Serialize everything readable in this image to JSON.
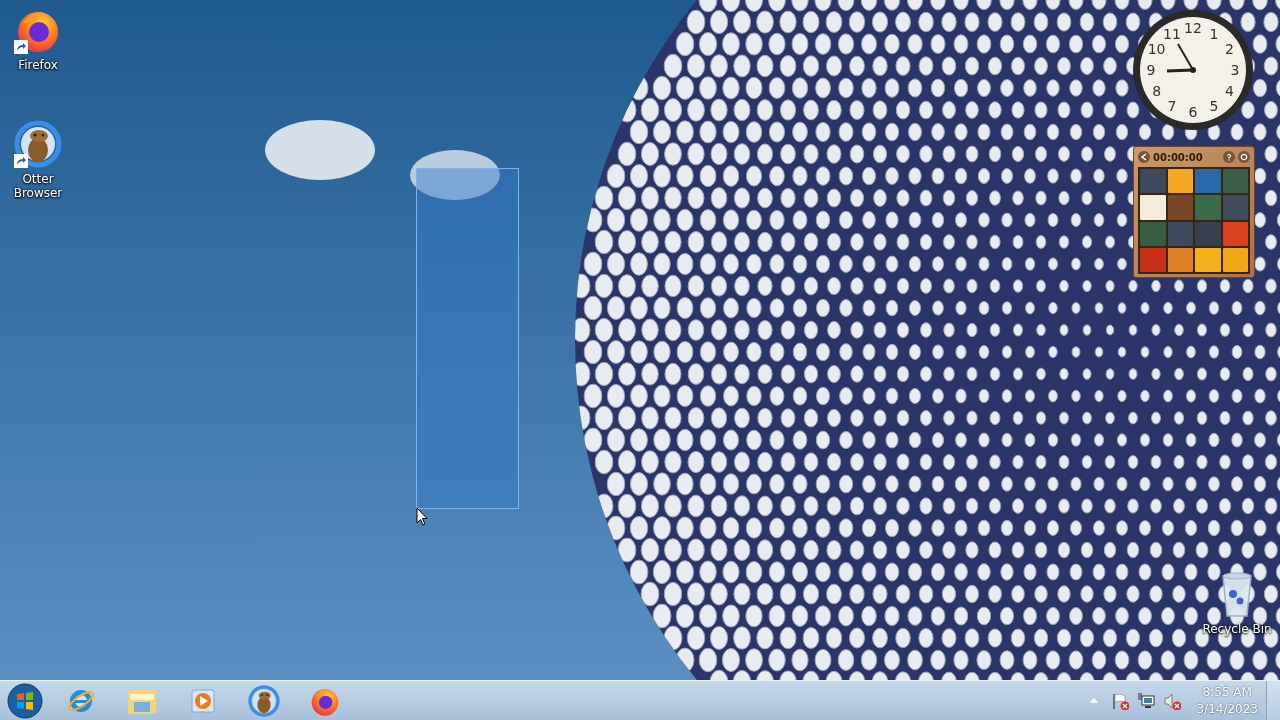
{
  "desktop_icons": [
    {
      "kind": "firefox",
      "label": "Firefox",
      "shortcut": true
    },
    {
      "kind": "otter",
      "label": "Otter Browser",
      "shortcut": true
    },
    {
      "kind": "recycle",
      "label": "Recycle Bin",
      "shortcut": false
    }
  ],
  "clock_gadget": {
    "numbers": [
      "12",
      "11",
      "1",
      "10",
      "2",
      "9",
      "3",
      "8",
      "4",
      "7",
      "5",
      "6"
    ]
  },
  "puzzle_gadget": {
    "timer": "00:00:00"
  },
  "taskbar": {
    "pinned": [
      {
        "kind": "ie"
      },
      {
        "kind": "explorer"
      },
      {
        "kind": "media"
      },
      {
        "kind": "otter"
      },
      {
        "kind": "firefox"
      }
    ],
    "tray_icons": [
      {
        "kind": "flag"
      },
      {
        "kind": "network"
      },
      {
        "kind": "speaker"
      }
    ],
    "time": "8:55 AM",
    "date": "3/14/2023"
  }
}
